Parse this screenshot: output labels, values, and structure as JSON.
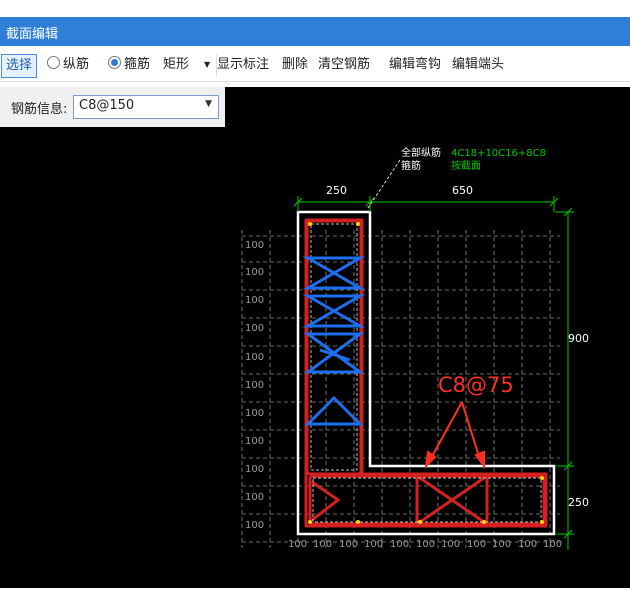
{
  "window": {
    "title": "截面编辑"
  },
  "toolbar": {
    "select_label": "选择",
    "longitudinal_label": "纵筋",
    "stirrup_label": "箍筋",
    "shape_label": "矩形",
    "show_annotations_label": "显示标注",
    "delete_label": "删除",
    "clear_rebar_label": "清空钢筋",
    "edit_hook_label": "编辑弯钩",
    "edit_end_label": "编辑端头",
    "longitudinal_selected": false,
    "stirrup_selected": true
  },
  "rebar_info": {
    "label": "钢筋信息:",
    "value": "C8@150"
  },
  "drawing": {
    "annotation_all_longitudinal": "全部纵筋",
    "annotation_stirrup": "箍筋",
    "longitudinal_spec": "4C18+10C16+8C8",
    "stirrup_spec": "按截面",
    "dim_top_left": "250",
    "dim_top_right": "650",
    "dim_right_upper": "900",
    "dim_right_lower": "250",
    "grid_label": "100",
    "callout_label": "C8@75",
    "colors": {
      "background": "#000000",
      "section_outline": "#ffffff",
      "stirrup_red": "#d42020",
      "stirrup_blue": "#1e6ef0",
      "dimension_green": "#00c800",
      "callout_red": "#ff3020",
      "grid": "#8a8a8a"
    }
  }
}
